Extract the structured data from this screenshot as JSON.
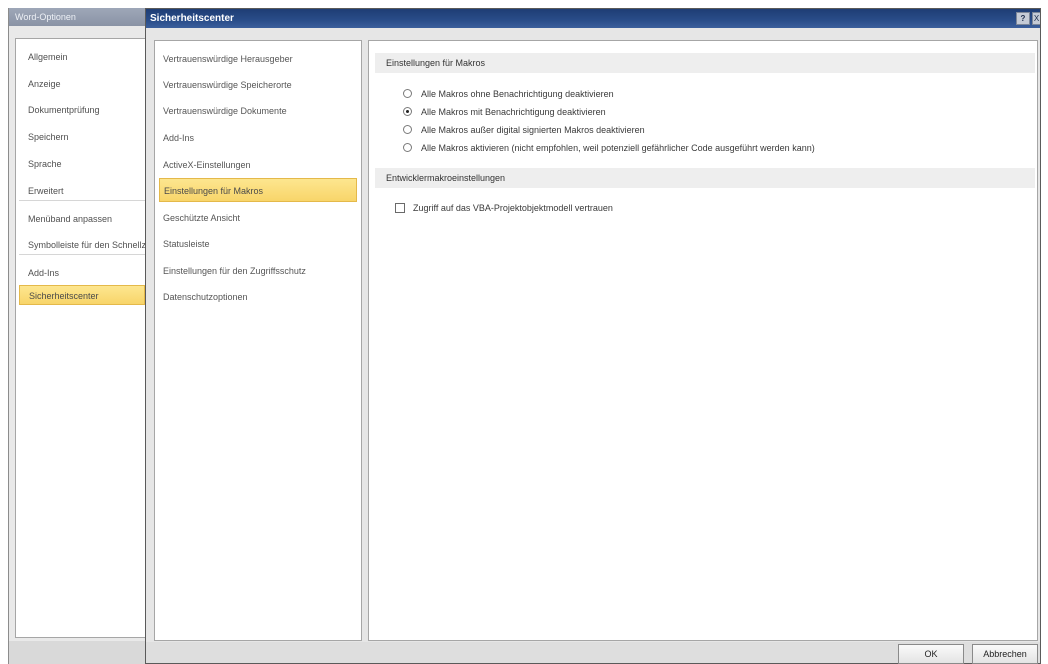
{
  "back_window": {
    "title": "Word-Optionen",
    "nav_items": [
      "Allgemein",
      "Anzeige",
      "Dokumentprüfung",
      "Speichern",
      "Sprache",
      "Erweitert",
      "Menüband anpassen",
      "Symbolleiste für den Schnellzugriff",
      "Add-Ins",
      "Sicherheitscenter"
    ],
    "selected_index": 9
  },
  "dialog": {
    "title": "Sicherheitscenter",
    "help_label": "?",
    "close_label": "X"
  },
  "left_nav": {
    "items": [
      "Vertrauenswürdige Herausgeber",
      "Vertrauenswürdige Speicherorte",
      "Vertrauenswürdige Dokumente",
      "Add-Ins",
      "ActiveX-Einstellungen",
      "Einstellungen für Makros",
      "Geschützte Ansicht",
      "Statusleiste",
      "Einstellungen für den Zugriffsschutz",
      "Datenschutzoptionen"
    ],
    "selected_index": 5
  },
  "content": {
    "macro_section_title": "Einstellungen für Makros",
    "macro_options": [
      {
        "label": "Alle Makros ohne Benachrichtigung deaktivieren",
        "checked": false
      },
      {
        "label": "Alle Makros mit Benachrichtigung deaktivieren",
        "checked": true
      },
      {
        "label": "Alle Makros außer digital signierten Makros deaktivieren",
        "checked": false
      },
      {
        "label": "Alle Makros aktivieren (nicht empfohlen, weil potenziell gefährlicher Code ausgeführt werden kann)",
        "checked": false
      }
    ],
    "developer_section_title": "Entwicklermakroeinstellungen",
    "vba_checkbox": {
      "label": "Zugriff auf das VBA-Projektobjektmodell vertrauen",
      "checked": false
    }
  },
  "footer": {
    "ok_label": "OK",
    "cancel_label": "Abbrechen"
  }
}
